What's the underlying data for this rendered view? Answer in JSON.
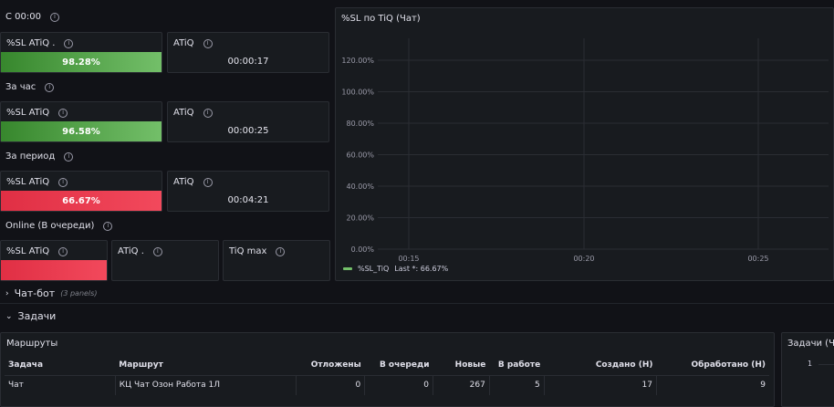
{
  "sections": {
    "since_midnight": "С 00:00",
    "per_hour": "За час",
    "per_period": "За период",
    "online": "Online (В очереди)"
  },
  "panels": {
    "r1_sl": {
      "title": "%SL ATiQ .",
      "value": "98.28%",
      "level": 0.9828
    },
    "r1_atiq": {
      "title": "ATiQ",
      "value": "00:00:17"
    },
    "r2_sl": {
      "title": "%SL ATiQ",
      "value": "96.58%",
      "level": 0.9658
    },
    "r2_atiq": {
      "title": "ATiQ",
      "value": "00:00:25"
    },
    "r3_sl": {
      "title": "%SL ATiQ",
      "value": "66.67%",
      "level": 0.6667
    },
    "r3_atiq": {
      "title": "ATiQ",
      "value": "00:04:21"
    },
    "r4_sl": {
      "title": "%SL ATiQ"
    },
    "r4_atiq": {
      "title": "ATiQ ."
    },
    "r4_tiq": {
      "title": "TiQ max"
    }
  },
  "chart_panel": {
    "title": "%SL по TiQ (Чат)",
    "legend_series": "%SL_TiQ",
    "legend_last": "Last *: 66.67%"
  },
  "chart_data": {
    "type": "line",
    "title": "%SL по TiQ (Чат)",
    "y_ticks": [
      "0.00%",
      "20.00%",
      "40.00%",
      "60.00%",
      "80.00%",
      "100.00%",
      "120.00%"
    ],
    "x_ticks": [
      "00:15",
      "00:20",
      "00:25"
    ],
    "ylim": [
      0,
      120
    ],
    "series": [
      {
        "name": "%SL_TiQ",
        "values": [],
        "color": "#73bf69"
      }
    ],
    "grid": true,
    "legend": "bottom-left"
  },
  "rows": {
    "chatbot": {
      "label": "Чат-бот",
      "note": "(3 panels)"
    },
    "tasks": {
      "label": "Задачи"
    }
  },
  "routes_panel": {
    "title": "Маршруты",
    "headers": [
      "Задача",
      "Маршрут",
      "Отложены",
      "В очереди",
      "Новые",
      "В работе",
      "Создано (Н)",
      "Обработано (Н)"
    ],
    "rows": [
      [
        "Чат",
        "КЦ Чат Озон Работа 1Л",
        "0",
        "0",
        "267",
        "5",
        "17",
        "9"
      ]
    ]
  },
  "tasks_panel": {
    "title": "Задачи (Ча",
    "y_tick": "1"
  },
  "colors": {
    "background": "#111217",
    "panel": "#181b1f",
    "green": "#73bf69",
    "red": "#f2495c"
  }
}
